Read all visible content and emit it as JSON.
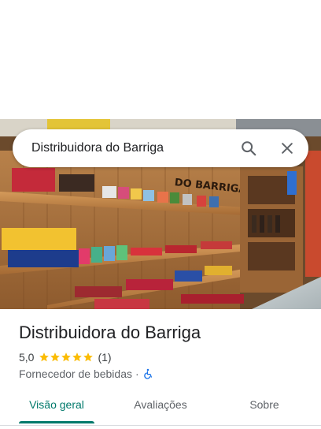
{
  "search": {
    "query": "Distribuidora do Barriga"
  },
  "photo": {
    "sign_text": "DO BARRIGA",
    "alt": "Foto da loja"
  },
  "place": {
    "name": "Distribuidora do Barriga",
    "rating": "5,0",
    "rating_value": 5,
    "stars_max": 5,
    "review_count": "(1)",
    "category": "Fornecedor de bebidas",
    "separator": "·",
    "accessibility_icon": "wheelchair-icon"
  },
  "tabs": [
    {
      "label": "Visão geral",
      "active": true
    },
    {
      "label": "Avaliações",
      "active": false
    },
    {
      "label": "Sobre",
      "active": false
    }
  ],
  "colors": {
    "accent": "#00796b",
    "star": "#fbbc04",
    "accessibility": "#1a73e8",
    "text_primary": "#202124",
    "text_secondary": "#5f6368"
  }
}
